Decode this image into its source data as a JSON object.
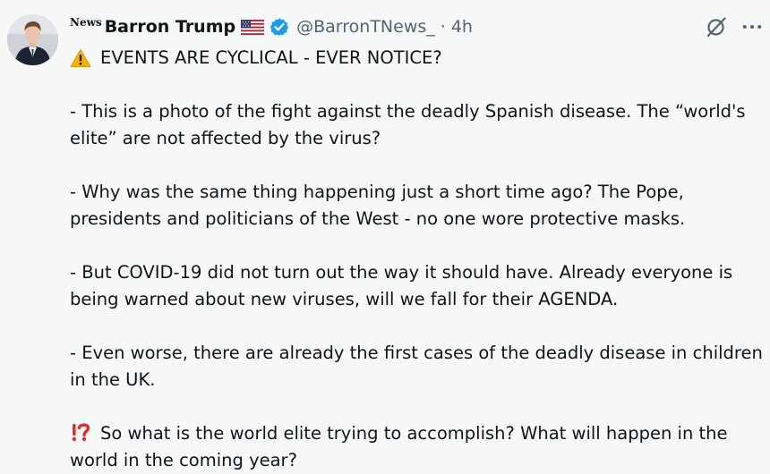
{
  "tweet": {
    "author": {
      "news_tag": "News",
      "name": "Barron Trump",
      "handle": "@BarronTNews_",
      "separator": "·",
      "time": "4h"
    },
    "icons": {
      "avatar": "profile-photo",
      "flag": "us-flag-icon",
      "verified": "verified-badge-icon",
      "grok": "grok-icon",
      "more": "more-icon",
      "warning": "warning-emoji-icon",
      "interrobang": "interrobang-emoji-icon"
    },
    "colors": {
      "verified_blue": "#1d9bf0",
      "interrobang_red": "#e02d2d",
      "secondary_text": "#536471"
    },
    "heading": "EVENTS ARE CYCLICAL - EVER NOTICE?",
    "paragraphs": [
      "- This is a photo of the fight against the deadly Spanish disease. The “world's elite” are not affected by the virus?",
      "- Why was the same thing happening just a short time ago? The Pope, presidents and politicians of the West - no one wore protective masks.",
      "- But COVID-19 did not turn out the way it should have. Already everyone is being warned about new viruses, will we fall for their AGENDA.",
      "- Even worse, there are already the first cases of the deadly disease in children in the UK."
    ],
    "closing": "So what is the world elite trying to accomplish? What will happen in the world in the coming year?"
  }
}
